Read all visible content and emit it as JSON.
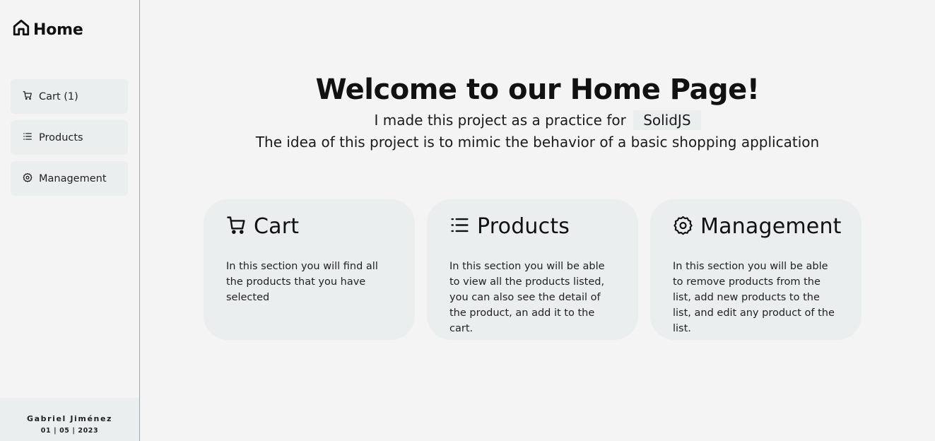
{
  "sidebar": {
    "brand": {
      "label": "Home",
      "icon": "home-icon"
    },
    "items": [
      {
        "label": "Cart (1)",
        "icon": "cart-icon"
      },
      {
        "label": "Products",
        "icon": "list-icon"
      },
      {
        "label": "Management",
        "icon": "gear-icon"
      }
    ],
    "footer": {
      "name": "Gabriel Jiménez",
      "date": "01 | 05 | 2023"
    }
  },
  "hero": {
    "title": "Welcome to our Home Page!",
    "line1_prefix": "I made this project as a practice for",
    "line1_chip": "SolidJS",
    "line2": "The idea of this project is to mimic the behavior of a basic shopping application"
  },
  "cards": [
    {
      "title": "Cart",
      "icon": "cart-icon",
      "description": "In this section you will find all the products that you have selected"
    },
    {
      "title": "Products",
      "icon": "list-icon",
      "description": "In this section you will be able to view all the products listed, you can also see the detail of the product, an add it to the cart."
    },
    {
      "title": "Management",
      "icon": "gear-icon",
      "description": "In this section you will be able to remove products from the list, add new products to the list, and edit any product of the list."
    }
  ]
}
